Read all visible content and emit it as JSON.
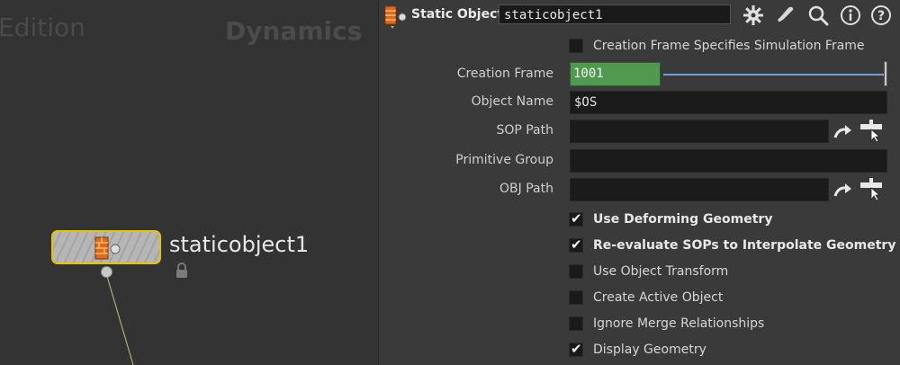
{
  "network": {
    "watermark_left": "Edition",
    "watermark_right": "Dynamics",
    "node_label": "staticobject1"
  },
  "header": {
    "title": "Static Object",
    "node_name": "staticobject1",
    "icons": [
      "gear-icon",
      "wrench-icon",
      "search-icon",
      "info-icon",
      "help-icon"
    ]
  },
  "params": {
    "creation_frame_specifies": {
      "label": "Creation Frame Specifies Simulation Frame",
      "checked": false
    },
    "creation_frame": {
      "label": "Creation Frame",
      "value": "1001"
    },
    "object_name": {
      "label": "Object Name",
      "value": "$OS"
    },
    "sop_path": {
      "label": "SOP Path",
      "value": ""
    },
    "primitive_group": {
      "label": "Primitive Group",
      "value": ""
    },
    "obj_path": {
      "label": "OBJ Path",
      "value": ""
    },
    "toggles": [
      {
        "label": "Use Deforming Geometry",
        "checked": true
      },
      {
        "label": "Re-evaluate SOPs to Interpolate Geometry",
        "checked": true
      },
      {
        "label": "Use Object Transform",
        "checked": false
      },
      {
        "label": "Create Active Object",
        "checked": false
      },
      {
        "label": "Ignore Merge Relationships",
        "checked": false
      },
      {
        "label": "Display Geometry",
        "checked": true
      }
    ]
  },
  "colors": {
    "node_outline": "#e8c300",
    "frame_field": "#4f9a4f",
    "annotation_arrow": "#1414d4"
  }
}
